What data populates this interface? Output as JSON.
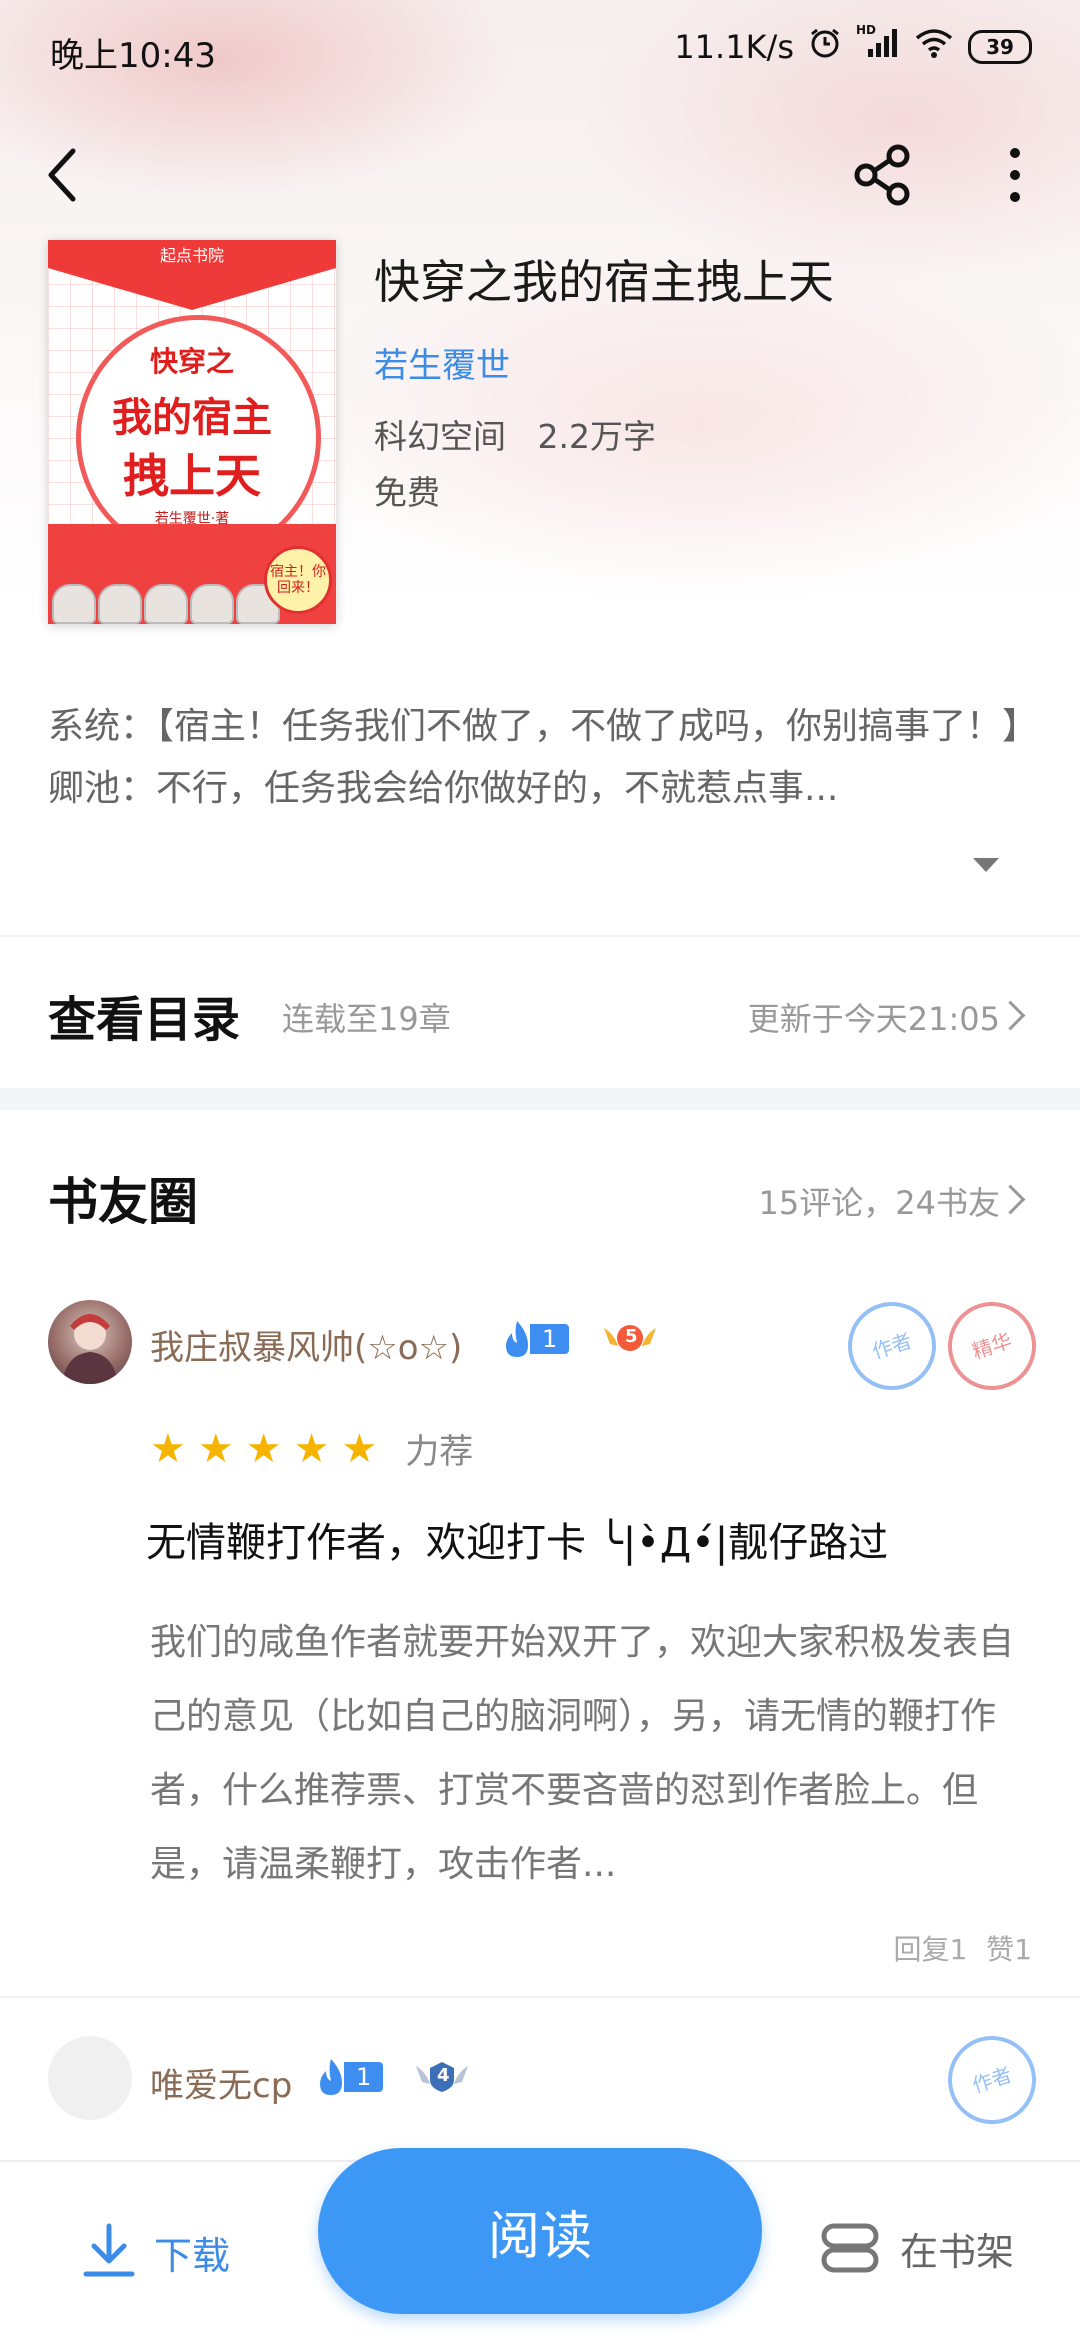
{
  "status_bar": {
    "time": "晚上10:43",
    "network_speed": "11.1K/s",
    "battery": "39",
    "hd_label": "HD"
  },
  "book": {
    "title": "快穿之我的宿主拽上天",
    "author": "若生覆世",
    "meta": "科幻空间   2.2万字",
    "price": "免费",
    "cover": {
      "publisher": "起点书院",
      "line1": "快穿之",
      "line2": "我的宿主",
      "line3": "拽上天",
      "author_tag": "若生覆世·著",
      "badge": "宿主！你回来！"
    }
  },
  "description": "系统：【宿主！任务我们不做了，不做了成吗，你别搞事了！】卿池：不行，任务我会给你做好的，不就惹点事...",
  "catalog": {
    "title": "查看目录",
    "status": "连载至19章",
    "updated": "更新于今天21:05"
  },
  "book_circle": {
    "title": "书友圈",
    "stats": "15评论，24书友"
  },
  "comments": [
    {
      "username": "我庄叔暴风帅(☆o☆)",
      "level": "1",
      "fan_level": "5",
      "stamps": [
        "作者",
        "精华"
      ],
      "rating": 5,
      "rating_label": "力荐",
      "title": "无情鞭打作者，欢迎打卡 ╰|•̀Д•́|靓仔路过",
      "body": "我们的咸鱼作者就要开始双开了，欢迎大家积极发表自己的意见（比如自己的脑洞啊），另，请无情的鞭打作者，什么推荐票、打赏不要吝啬的怼到作者脸上。但是，请温柔鞭打，攻击作者...",
      "replies": "回复1",
      "likes": "赞1"
    },
    {
      "username": "唯爱无cp",
      "level": "1",
      "fan_level": "4",
      "stamps": [
        "作者"
      ]
    }
  ],
  "bottom_bar": {
    "download": "下载",
    "read": "阅读",
    "bookshelf": "在书架"
  },
  "colors": {
    "accent": "#3d98f5",
    "author": "#3b8ce6",
    "username": "#8a6b55",
    "star": "#f6b400"
  }
}
